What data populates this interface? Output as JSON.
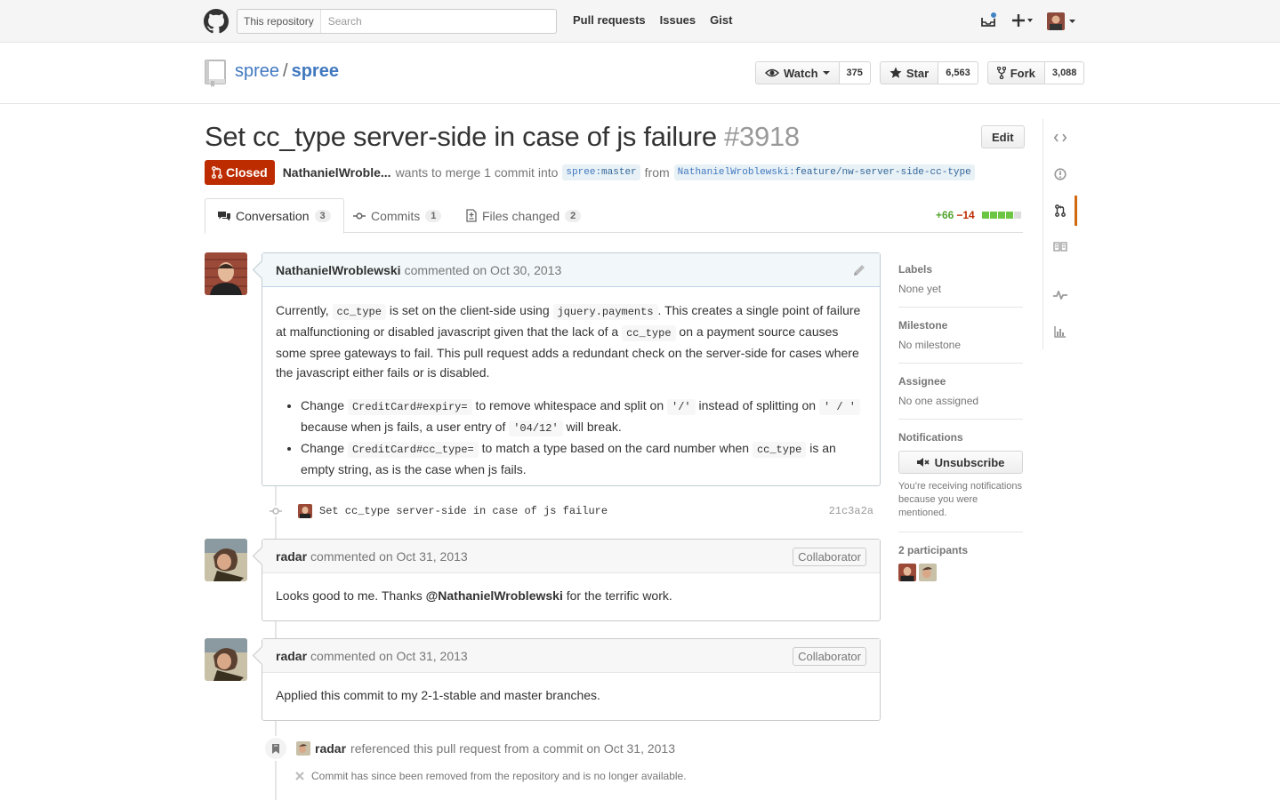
{
  "header": {
    "search_scope": "This repository",
    "search_placeholder": "Search",
    "nav": [
      "Pull requests",
      "Issues",
      "Gist"
    ]
  },
  "repo": {
    "owner": "spree",
    "separator": "/",
    "name": "spree",
    "watch_label": "Watch",
    "watch_count": "375",
    "star_label": "Star",
    "star_count": "6,563",
    "fork_label": "Fork",
    "fork_count": "3,088"
  },
  "pr": {
    "title": "Set cc_type server-side in case of js failure",
    "number": "#3918",
    "edit_label": "Edit",
    "state": "Closed",
    "author": "NathanielWroble...",
    "merge_text": "wants to merge 1 commit into",
    "base_owner": "spree",
    "base_branch": "master",
    "from_text": "from",
    "head_owner": "NathanielWroblewski",
    "head_branch": "feature/nw-server-side-cc-type"
  },
  "tabs": [
    {
      "label": "Conversation",
      "count": "3"
    },
    {
      "label": "Commits",
      "count": "1"
    },
    {
      "label": "Files changed",
      "count": "2"
    }
  ],
  "diffstat": {
    "additions": "+66",
    "deletions": "−14"
  },
  "comments": [
    {
      "author": "NathanielWroblewski",
      "meta": "commented on Oct 30, 2013",
      "p_parts": [
        "Currently, ",
        "cc_type",
        " is set on the client-side using ",
        "jquery.payments",
        ". This creates a single point of failure at malfunctioning or disabled javascript given that the lack of a ",
        "cc_type",
        " on a payment source causes some spree gateways to fail. This pull request adds a redundant check on the server-side for cases where the javascript either fails or is disabled."
      ],
      "li1_parts": [
        "Change ",
        "CreditCard#expiry=",
        " to remove whitespace and split on ",
        "'/'",
        " instead of splitting on ",
        "' / '",
        " because when js fails, a user entry of ",
        "'04/12'",
        " will break."
      ],
      "li2_parts": [
        "Change ",
        "CreditCard#cc_type=",
        " to match a type based on the card number when ",
        "cc_type",
        " is an empty string, as is the case when js fails."
      ]
    },
    {
      "author": "radar",
      "meta": "commented on Oct 31, 2013",
      "badge": "Collaborator",
      "body_pre": "Looks good to me. Thanks ",
      "mention": "@NathanielWroblewski",
      "body_post": " for the terrific work."
    },
    {
      "author": "radar",
      "meta": "commented on Oct 31, 2013",
      "badge": "Collaborator",
      "body": "Applied this commit to my 2-1-stable and master branches."
    }
  ],
  "commit": {
    "message": "Set cc_type server-side in case of js failure",
    "sha": "21c3a2a"
  },
  "reference": {
    "author": "radar",
    "text": "referenced this pull request from a commit on Oct 31, 2013",
    "removed": "Commit has since been removed from the repository and is no longer available."
  },
  "sidebar": {
    "labels_heading": "Labels",
    "labels_value": "None yet",
    "milestone_heading": "Milestone",
    "milestone_value": "No milestone",
    "assignee_heading": "Assignee",
    "assignee_value": "No one assigned",
    "notifications_heading": "Notifications",
    "unsubscribe_label": "Unsubscribe",
    "notifications_note": "You’re receiving notifications because you were mentioned.",
    "participants_heading": "2 participants"
  },
  "colors": {
    "closed": "#bd2c00",
    "link": "#4078c0",
    "addition": "#55a532",
    "accent": "#d26911"
  }
}
